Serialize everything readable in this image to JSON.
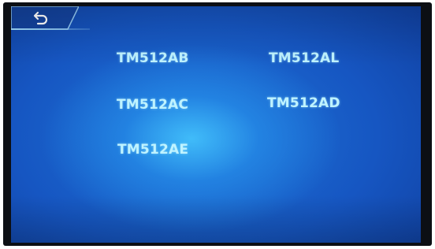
{
  "back_button": {
    "icon": "back-arrow-icon"
  },
  "items": [
    {
      "label": "TM512AB"
    },
    {
      "label": "TM512AL"
    },
    {
      "label": "TM512AC"
    },
    {
      "label": "TM512AD"
    },
    {
      "label": "TM512AE"
    }
  ],
  "colors": {
    "screen_dark": "#0f3c9a",
    "screen_mid": "#1656c2",
    "screen_glow": "#46c8ff",
    "label_text": "#bff3ff",
    "bezel": "#0c0f14"
  }
}
